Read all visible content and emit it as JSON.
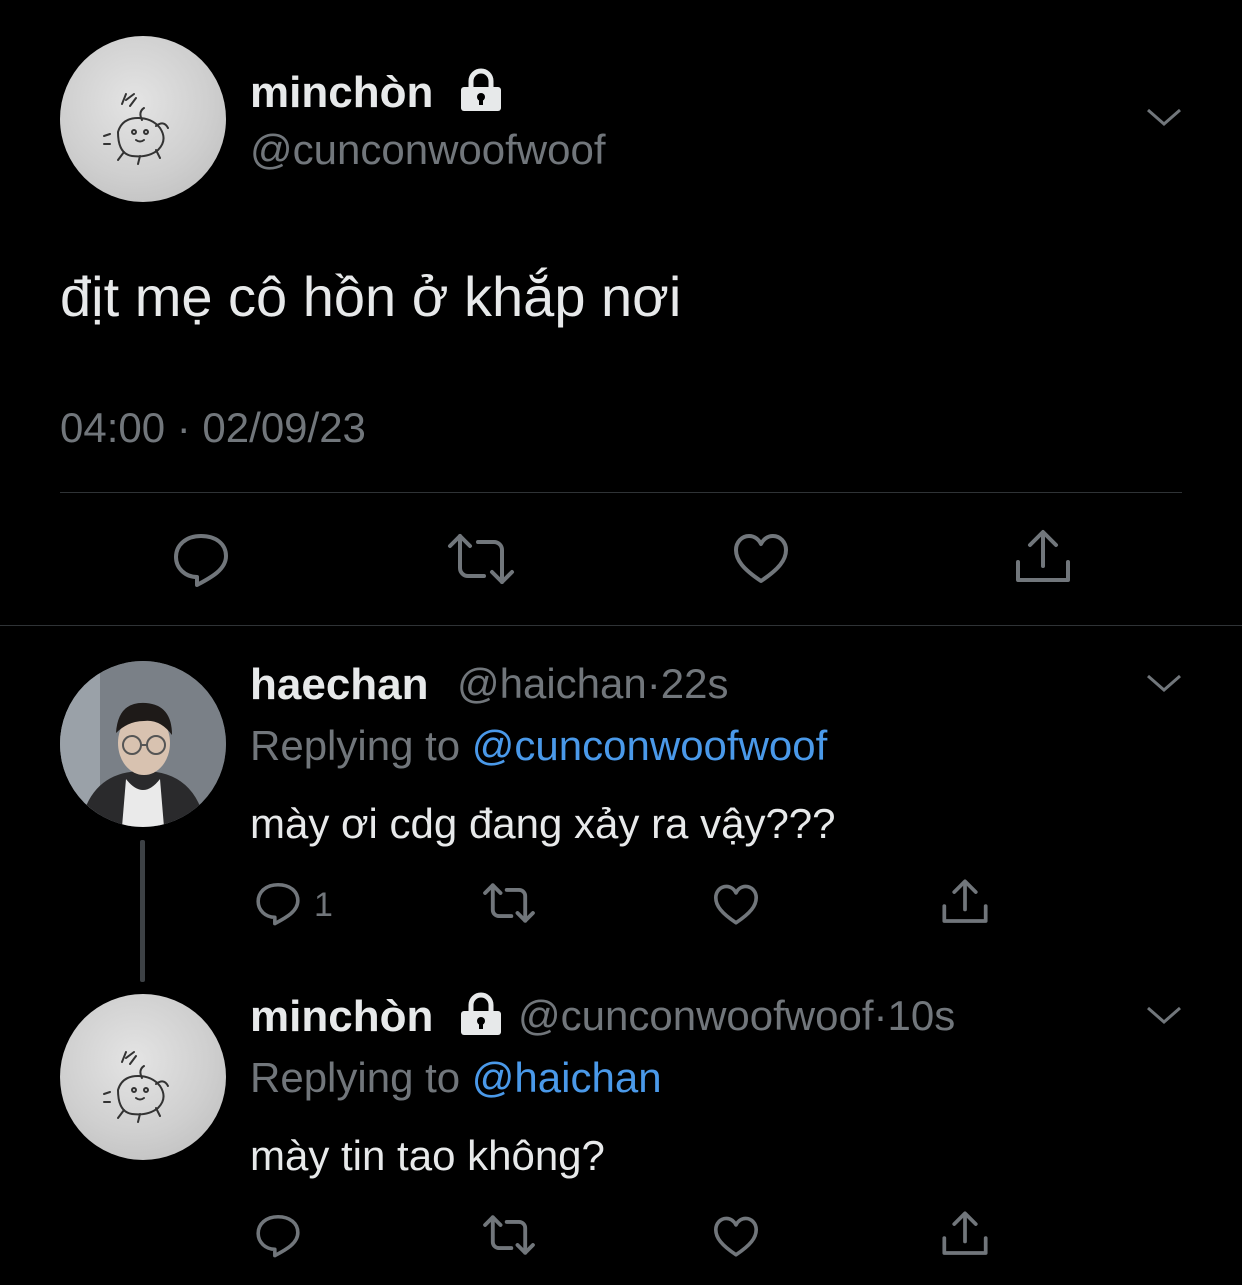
{
  "main_tweet": {
    "display_name": "minchòn",
    "handle": "@cunconwoofwoof",
    "locked_icon": "lock-icon",
    "text": "địt mẹ cô hồn ở khắp nơi",
    "timestamp": "04:00 · 02/09/23",
    "actions": [
      "reply-icon",
      "retweet-icon",
      "like-icon",
      "share-icon"
    ]
  },
  "replies": [
    {
      "display_name": "haechan",
      "handle": "@haichan",
      "separator": "·",
      "time": "22s",
      "replying_prefix": "Replying to",
      "replying_to": "@cunconwoofwoof",
      "text": "mày ơi cdg đang xảy ra vậy???",
      "reply_count": "1"
    },
    {
      "display_name": "minchòn",
      "handle": "@cunconwoofwoof",
      "separator": "·",
      "time": "10s",
      "replying_prefix": "Replying to",
      "replying_to": "@haichan",
      "text": "mày tin tao không?",
      "reply_count": ""
    }
  ],
  "colors": {
    "background": "#000000",
    "text": "#e7e9ea",
    "muted": "#71767b",
    "link": "#4a99e9",
    "divider": "#2f3336"
  }
}
